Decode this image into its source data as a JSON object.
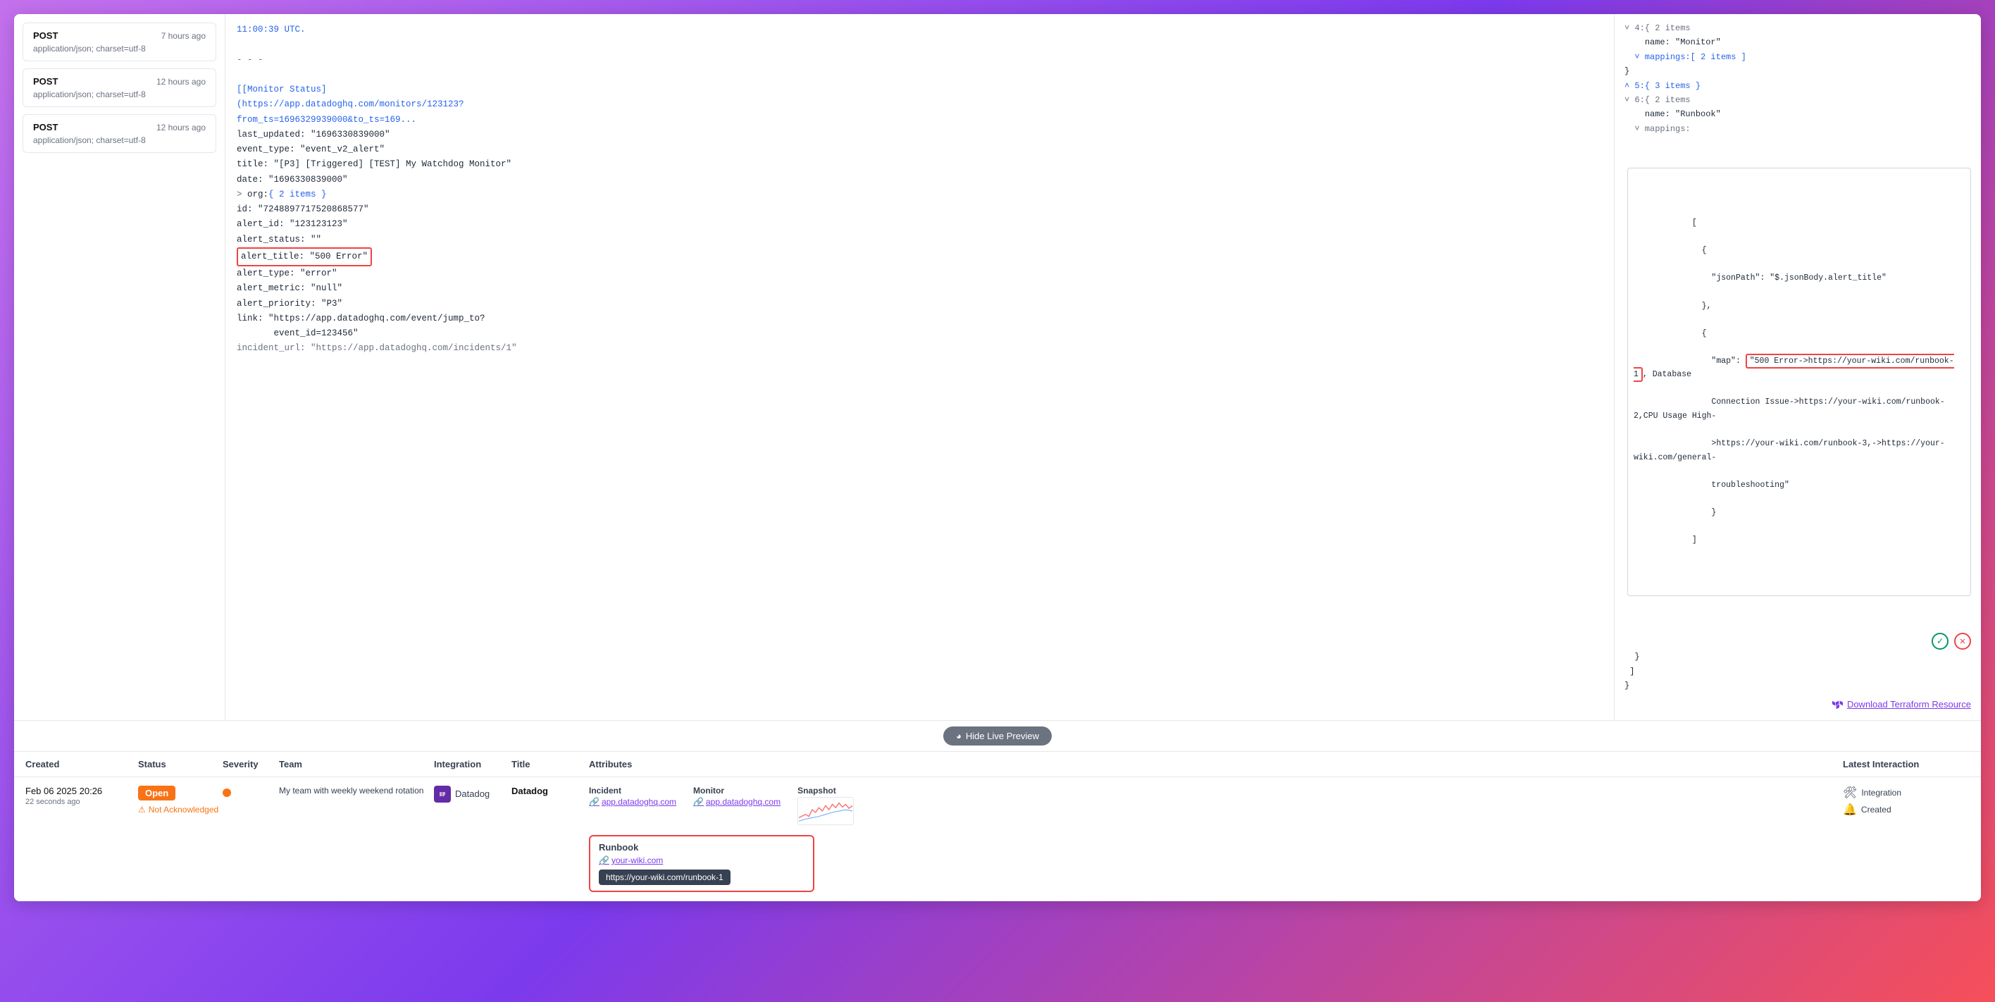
{
  "left_panel": {
    "requests": [
      {
        "method": "POST",
        "time": "7 hours ago",
        "content_type": "application/json; charset=utf-8"
      },
      {
        "method": "POST",
        "time": "12 hours ago",
        "content_type": "application/json; charset=utf-8"
      },
      {
        "method": "POST",
        "time": "12 hours ago",
        "content_type": "application/json; charset=utf-8"
      }
    ]
  },
  "center_panel": {
    "lines": [
      {
        "text": "11:00:39 UTC.",
        "class": "c-blue"
      },
      {
        "text": "",
        "class": ""
      },
      {
        "text": "- - -",
        "class": "c-gray"
      },
      {
        "text": "",
        "class": ""
      },
      {
        "text": "[[Monitor Status]",
        "class": "c-blue"
      },
      {
        "text": "(https://app.datadoghq.com/monitors/123123?",
        "class": "c-blue"
      },
      {
        "text": "from_ts=1696329939000&to_ts=169...",
        "class": "c-blue"
      },
      {
        "text": "last_updated: \"1696330839000\"",
        "class": "c-dark"
      },
      {
        "text": "event_type: \"event_v2_alert\"",
        "class": "c-dark"
      },
      {
        "text": "title: \"[P3] [Triggered] [TEST] My Watchdog Monitor\"",
        "class": "c-dark"
      },
      {
        "text": "date: \"1696330839000\"",
        "class": "c-dark"
      },
      {
        "text": "> org:{ 2 items }",
        "class": "c-dark"
      },
      {
        "text": "id: \"7248897717520868577\"",
        "class": "c-dark"
      },
      {
        "text": "alert_id: \"123123123\"",
        "class": "c-dark"
      },
      {
        "text": "alert_status: \"\"",
        "class": "c-dark"
      },
      {
        "text": "alert_title: \"500 Error\"",
        "class": "c-dark",
        "highlight": true
      },
      {
        "text": "alert_type: \"error\"",
        "class": "c-dark"
      },
      {
        "text": "alert_metric: \"null\"",
        "class": "c-dark"
      },
      {
        "text": "alert_priority: \"P3\"",
        "class": "c-dark"
      },
      {
        "text": "link: \"https://app.datadoghq.com/event/jump_to?",
        "class": "c-dark"
      },
      {
        "text": "       event_id=123456\"",
        "class": "c-dark"
      },
      {
        "text": "incident_url: \"https://app.datadoghq.com/incidents/1\"",
        "class": "c-gray"
      }
    ]
  },
  "right_panel": {
    "terraform_link": "Download Terraform Resource",
    "mapping_value": "\"500 Error->https://your-wiki.com/runbook-1, Database Connection Issue->https://your-wiki.com/runbook-2,CPU Usage High->https://your-wiki.com/runbook-3,->https://your-wiki.com/general-troubleshooting\"",
    "json_path": "\"$.jsonBody.alert_title\""
  },
  "hide_preview": {
    "label": "Hide Live Preview"
  },
  "table": {
    "headers": [
      "Created",
      "Status",
      "Severity",
      "Team",
      "Integration",
      "Title",
      "Attributes",
      "Latest Interaction"
    ],
    "rows": [
      {
        "created_date": "Feb 06 2025 20:26",
        "created_ago": "22 seconds ago",
        "status": "Open",
        "not_acknowledged": "Not Acknowledged",
        "severity": "",
        "team": "My team with weekly weekend rotation",
        "integration_logo": "DD",
        "integration_name": "Datadog",
        "title": "Datadog",
        "incident_label": "Incident",
        "incident_link": "app.datadoghq.com",
        "monitor_label": "Monitor",
        "monitor_link": "app.datadoghq.com",
        "snapshot_label": "Snapshot",
        "runbook_label": "Runbook",
        "runbook_link": "your-wiki.com",
        "runbook_tooltip": "https://your-wiki.com/runbook-1",
        "latest_interaction_integration": "Integration",
        "latest_interaction_created": "Created"
      }
    ]
  }
}
